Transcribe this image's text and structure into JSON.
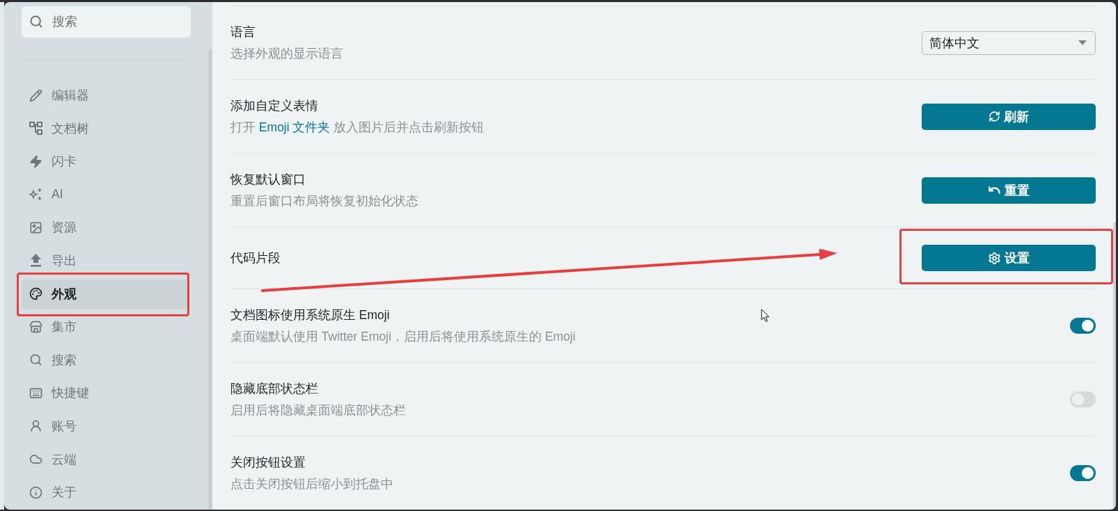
{
  "sidebar": {
    "search": {
      "placeholder": "搜索"
    },
    "items": [
      {
        "label": "编辑器",
        "selected": false,
        "annotated": false
      },
      {
        "label": "文档树",
        "selected": false,
        "annotated": false
      },
      {
        "label": "闪卡",
        "selected": false,
        "annotated": false
      },
      {
        "label": "AI",
        "selected": false,
        "annotated": false
      },
      {
        "label": "资源",
        "selected": false,
        "annotated": false
      },
      {
        "label": "导出",
        "selected": false,
        "annotated": false
      },
      {
        "label": "外观",
        "selected": true,
        "annotated": true
      },
      {
        "label": "集市",
        "selected": false,
        "annotated": false
      },
      {
        "label": "搜索",
        "selected": false,
        "annotated": false
      },
      {
        "label": "快捷键",
        "selected": false,
        "annotated": false
      },
      {
        "label": "账号",
        "selected": false,
        "annotated": false
      },
      {
        "label": "云端",
        "selected": false,
        "annotated": false
      },
      {
        "label": "关于",
        "selected": false,
        "annotated": false
      }
    ]
  },
  "settings": [
    {
      "title": "语言",
      "description": [
        {
          "text": "选择外观的显示语言",
          "link": false
        }
      ],
      "annotated": false,
      "control": {
        "kind": "select",
        "value": "简体中文"
      }
    },
    {
      "title": "添加自定义表情",
      "description": [
        {
          "text": "打开 ",
          "link": false
        },
        {
          "text": "Emoji 文件夹",
          "link": true
        },
        {
          "text": " 放入图片后并点击刷新按钮",
          "link": false
        }
      ],
      "annotated": false,
      "control": {
        "kind": "button",
        "label": "刷新"
      }
    },
    {
      "title": "恢复默认窗口",
      "description": [
        {
          "text": "重置后窗口布局将恢复初始化状态",
          "link": false
        }
      ],
      "annotated": false,
      "control": {
        "kind": "button",
        "label": "重置"
      }
    },
    {
      "title": "代码片段",
      "annotated": true,
      "control": {
        "kind": "button",
        "label": "设置"
      }
    },
    {
      "title": "文档图标使用系统原生 Emoji",
      "description": [
        {
          "text": "桌面端默认使用 Twitter Emoji，启用后将使用系统原生的 Emoji",
          "link": false
        }
      ],
      "annotated": false,
      "control": {
        "kind": "toggle",
        "on": true
      }
    },
    {
      "title": "隐藏底部状态栏",
      "description": [
        {
          "text": "启用后将隐藏桌面端底部状态栏",
          "link": false
        }
      ],
      "annotated": false,
      "control": {
        "kind": "toggle",
        "on": false
      }
    },
    {
      "title": "关闭按钮设置",
      "description": [
        {
          "text": "点击关闭按钮后缩小到托盘中",
          "link": false
        }
      ],
      "annotated": false,
      "control": {
        "kind": "toggle",
        "on": true
      }
    }
  ]
}
